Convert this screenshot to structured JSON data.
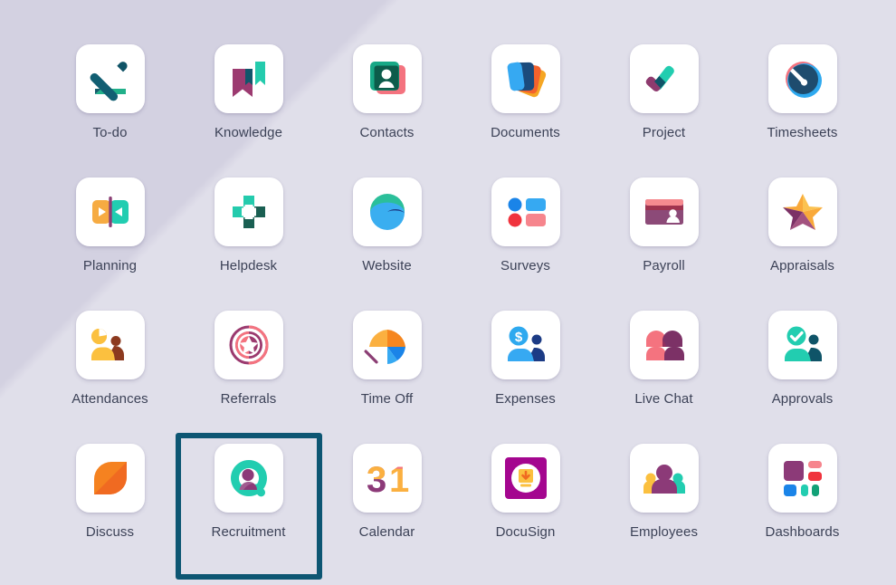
{
  "window": {
    "background_color": "#d3d1e1",
    "selection_border_color": "#0d5673",
    "label_color": "#3c4257",
    "tile_color": "#ffffff"
  },
  "launcher": {
    "columns": 6,
    "rows": 4,
    "selected_app": "Recruitment",
    "apps": [
      {
        "label": "To-do",
        "icon": "todo-pencil-icon",
        "selected": false
      },
      {
        "label": "Knowledge",
        "icon": "knowledge-bookmark-icon",
        "selected": false
      },
      {
        "label": "Contacts",
        "icon": "contacts-card-icon",
        "selected": false
      },
      {
        "label": "Documents",
        "icon": "documents-pages-icon",
        "selected": false
      },
      {
        "label": "Project",
        "icon": "project-check-icon",
        "selected": false
      },
      {
        "label": "Timesheets",
        "icon": "timesheets-clock-icon",
        "selected": false
      },
      {
        "label": "Planning",
        "icon": "planning-arrows-icon",
        "selected": false
      },
      {
        "label": "Helpdesk",
        "icon": "helpdesk-cross-icon",
        "selected": false
      },
      {
        "label": "Website",
        "icon": "website-globe-icon",
        "selected": false
      },
      {
        "label": "Surveys",
        "icon": "surveys-blocks-icon",
        "selected": false
      },
      {
        "label": "Payroll",
        "icon": "payroll-card-icon",
        "selected": false
      },
      {
        "label": "Appraisals",
        "icon": "appraisals-star-icon",
        "selected": false
      },
      {
        "label": "Attendances",
        "icon": "attendances-person-icon",
        "selected": false
      },
      {
        "label": "Referrals",
        "icon": "referrals-badge-icon",
        "selected": false
      },
      {
        "label": "Time Off",
        "icon": "timeoff-umbrella-icon",
        "selected": false
      },
      {
        "label": "Expenses",
        "icon": "expenses-dollar-icon",
        "selected": false
      },
      {
        "label": "Live Chat",
        "icon": "livechat-people-icon",
        "selected": false
      },
      {
        "label": "Approvals",
        "icon": "approvals-check-icon",
        "selected": false
      },
      {
        "label": "Discuss",
        "icon": "discuss-bubble-icon",
        "selected": false
      },
      {
        "label": "Recruitment",
        "icon": "recruitment-magnifier-icon",
        "selected": true
      },
      {
        "label": "Calendar",
        "icon": "calendar-31-icon",
        "selected": false
      },
      {
        "label": "DocuSign",
        "icon": "docusign-download-icon",
        "selected": false
      },
      {
        "label": "Employees",
        "icon": "employees-group-icon",
        "selected": false
      },
      {
        "label": "Dashboards",
        "icon": "dashboards-tiles-icon",
        "selected": false
      }
    ]
  }
}
